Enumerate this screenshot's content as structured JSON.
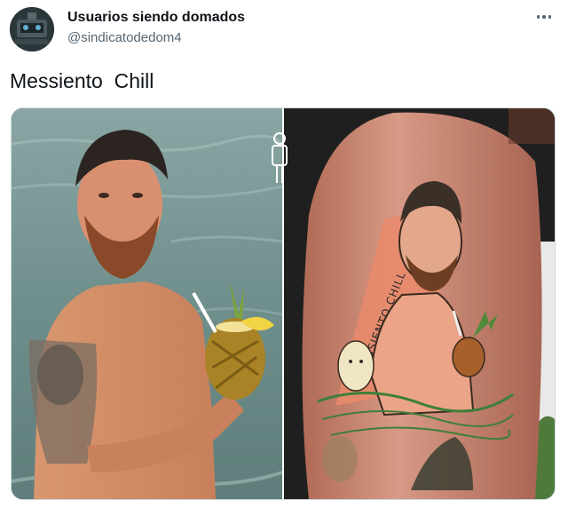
{
  "author": {
    "display_name": "Usuarios siendo domados",
    "handle": "@sindicatodedom4",
    "avatar_icon": "avatar-image"
  },
  "menu": {
    "icon": "more-horizontal-icon"
  },
  "tweet": {
    "text": "Messiento  Chill"
  },
  "media": {
    "photo_left": "man-in-sea-holding-pineapple-drink",
    "photo_right": "leg-tattoo-of-same-scene",
    "tattoo_caption": "MESSIENTO CHILL"
  },
  "colors": {
    "text_primary": "#0f1419",
    "text_secondary": "#536471",
    "border": "#cfd9de"
  }
}
